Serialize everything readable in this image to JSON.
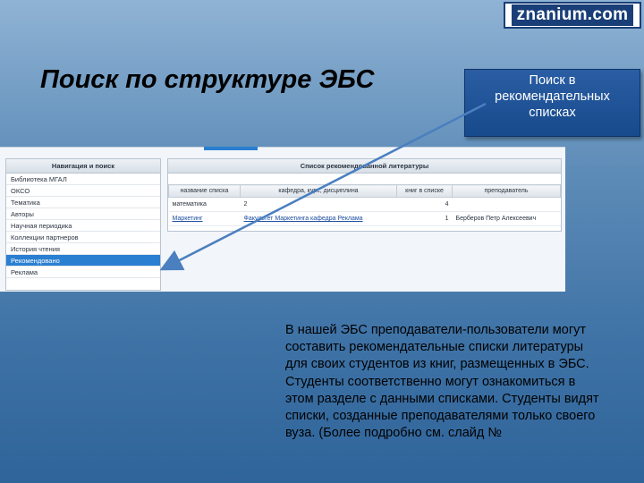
{
  "logo": {
    "text": "znanium.com"
  },
  "slide": {
    "title": "Поиск по структуре ЭБС"
  },
  "callout": {
    "lines": [
      "Поиск в",
      "рекомендательных",
      "списках"
    ]
  },
  "nav": {
    "header": "Навигация и поиск",
    "items": [
      {
        "label": "Библиотека МГАЛ",
        "active": false
      },
      {
        "label": "ОКСО",
        "active": false
      },
      {
        "label": "Тематика",
        "active": false
      },
      {
        "label": "Авторы",
        "active": false
      },
      {
        "label": "Научная периодика",
        "active": false
      },
      {
        "label": "Коллекции партнеров",
        "active": false
      },
      {
        "label": "История чтения",
        "active": false
      },
      {
        "label": "Рекомендовано",
        "active": true
      },
      {
        "label": "Реклама",
        "active": false
      }
    ]
  },
  "panel": {
    "header": "Список рекомендованной литературы",
    "columns": [
      "название списка",
      "кафедра, курс, дисциплина",
      "книг в списке",
      "преподаватель"
    ],
    "rows": [
      {
        "name": "математика",
        "dept": "2",
        "count": "4",
        "teacher": ""
      },
      {
        "name": "Маркетинг",
        "dept": "Факультет Маркетинга кафедра Реклама",
        "count": "1",
        "teacher": "Берберов Петр Алексеевич"
      }
    ]
  },
  "description": {
    "lines": [
      "В нашей ЭБС преподаватели-пользователи могут",
      "составить рекомендательные списки литературы",
      "для своих студентов из книг, размещенных в ЭБС.",
      "Студенты соответственно могут ознакомиться в",
      "этом разделе с данными списками. Студенты видят",
      "списки, созданные преподавателями только своего",
      "вуза. (Более подробно см. слайд №"
    ]
  },
  "colors": {
    "accent": "#2a7fd1",
    "callout_bg": "#1f5397",
    "arrow": "#4a7fc0"
  }
}
